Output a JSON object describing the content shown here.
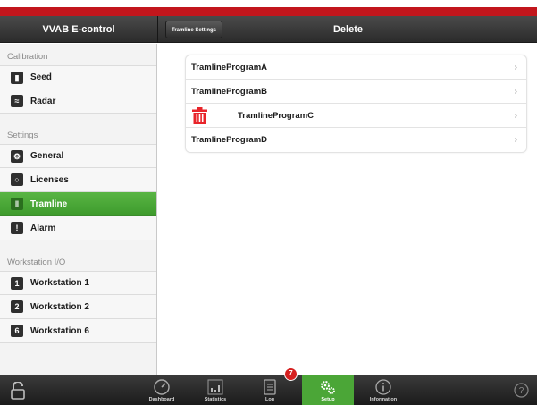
{
  "header": {
    "app_title": "VVAB E-control",
    "back_button_label": "Tramline Settings",
    "page_title": "Delete"
  },
  "sidebar": {
    "sections": [
      {
        "title": "Calibration",
        "items": [
          {
            "label": "Seed",
            "icon": "seed-icon"
          },
          {
            "label": "Radar",
            "icon": "radar-icon"
          }
        ]
      },
      {
        "title": "Settings",
        "items": [
          {
            "label": "General",
            "icon": "general-icon"
          },
          {
            "label": "Licenses",
            "icon": "licenses-icon"
          },
          {
            "label": "Tramline",
            "icon": "tramline-icon",
            "active": true
          },
          {
            "label": "Alarm",
            "icon": "alarm-icon"
          }
        ]
      },
      {
        "title": "Workstation I/O",
        "items": [
          {
            "label": "Workstation 1",
            "icon": "workstation-icon"
          },
          {
            "label": "Workstation 2",
            "icon": "workstation-icon"
          },
          {
            "label": "Workstation 6",
            "icon": "workstation-icon"
          }
        ]
      }
    ]
  },
  "programs": [
    {
      "name": "TramlineProgramA"
    },
    {
      "name": "TramlineProgramB"
    },
    {
      "name": "TramlineProgramC",
      "delete_mode": true
    },
    {
      "name": "TramlineProgramD"
    }
  ],
  "tabbar": {
    "tabs": [
      {
        "label": "Dashboard",
        "icon": "speedometer-icon"
      },
      {
        "label": "Statistics",
        "icon": "bar-chart-icon"
      },
      {
        "label": "Log",
        "icon": "log-icon"
      },
      {
        "label": "Setup",
        "icon": "gears-icon",
        "active": true
      },
      {
        "label": "Information",
        "icon": "info-icon"
      }
    ],
    "log_badge_count": "7"
  },
  "colors": {
    "accent_green": "#4ba637",
    "brand_red": "#c2161c",
    "delete_red": "#e8242a"
  }
}
